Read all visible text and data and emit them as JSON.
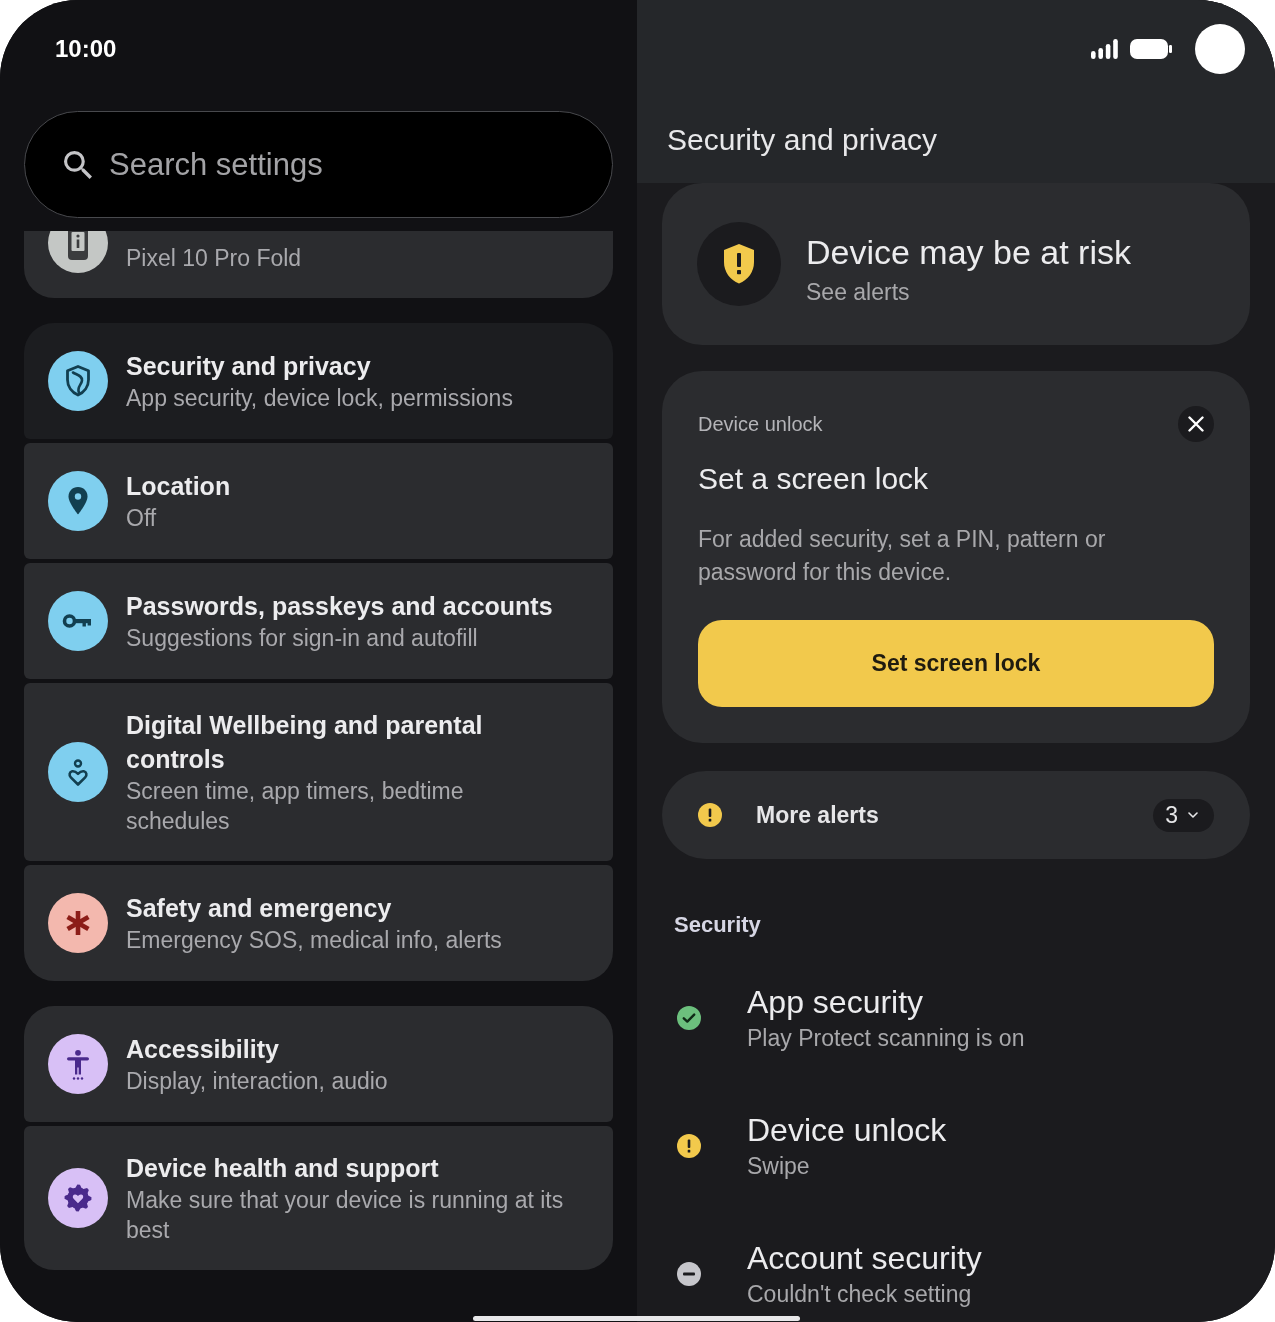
{
  "status_bar": {
    "time": "10:00"
  },
  "search": {
    "placeholder": "Search settings"
  },
  "settings_groups": [
    {
      "items": [
        {
          "kind": "about",
          "subtitle": "Pixel 10 Pro Fold",
          "color": "#c4c7c5",
          "selected": false
        }
      ]
    },
    {
      "items": [
        {
          "kind": "security",
          "title": "Security and privacy",
          "subtitle": "App security, device lock, permissions",
          "color": "#7fcfef",
          "selected": true
        },
        {
          "kind": "location",
          "title": "Location",
          "subtitle": "Off",
          "color": "#7fcfef",
          "selected": false
        },
        {
          "kind": "passwords",
          "title": "Passwords, passkeys and accounts",
          "subtitle": "Suggestions for sign-in and autofill",
          "color": "#7fcfef",
          "selected": false
        },
        {
          "kind": "wellbeing",
          "title": "Digital Wellbeing and parental controls",
          "subtitle": "Screen time, app timers, bedtime schedules",
          "color": "#7fcfef",
          "selected": false
        },
        {
          "kind": "safety",
          "title": "Safety and emergency",
          "subtitle": "Emergency SOS, medical info, alerts",
          "color": "#f3b8ae",
          "selected": false
        }
      ]
    },
    {
      "items": [
        {
          "kind": "accessibility",
          "title": "Accessibility",
          "subtitle": "Display, interaction, audio",
          "color": "#d8c0f6",
          "selected": false
        },
        {
          "kind": "health",
          "title": "Device health and support",
          "subtitle": "Make sure that your device is running at its best",
          "color": "#d8c0f6",
          "selected": false
        }
      ]
    }
  ],
  "detail": {
    "title": "Security and privacy",
    "risk_card": {
      "title": "Device may be at risk",
      "subtitle": "See alerts"
    },
    "alert_card": {
      "label": "Device unlock",
      "title": "Set a screen lock",
      "body": "For added security, set a PIN, pattern or password for this device.",
      "button": "Set screen lock"
    },
    "more_alerts": {
      "label": "More alerts",
      "count": "3",
      "expanded": false
    },
    "security_section": {
      "title": "Security",
      "items": [
        {
          "kind": "ok",
          "title": "App security",
          "subtitle": "Play Protect scanning is on"
        },
        {
          "kind": "warning",
          "title": "Device unlock",
          "subtitle": "Swipe"
        },
        {
          "kind": "unknown",
          "title": "Account security",
          "subtitle": "Couldn't check setting"
        }
      ]
    }
  }
}
